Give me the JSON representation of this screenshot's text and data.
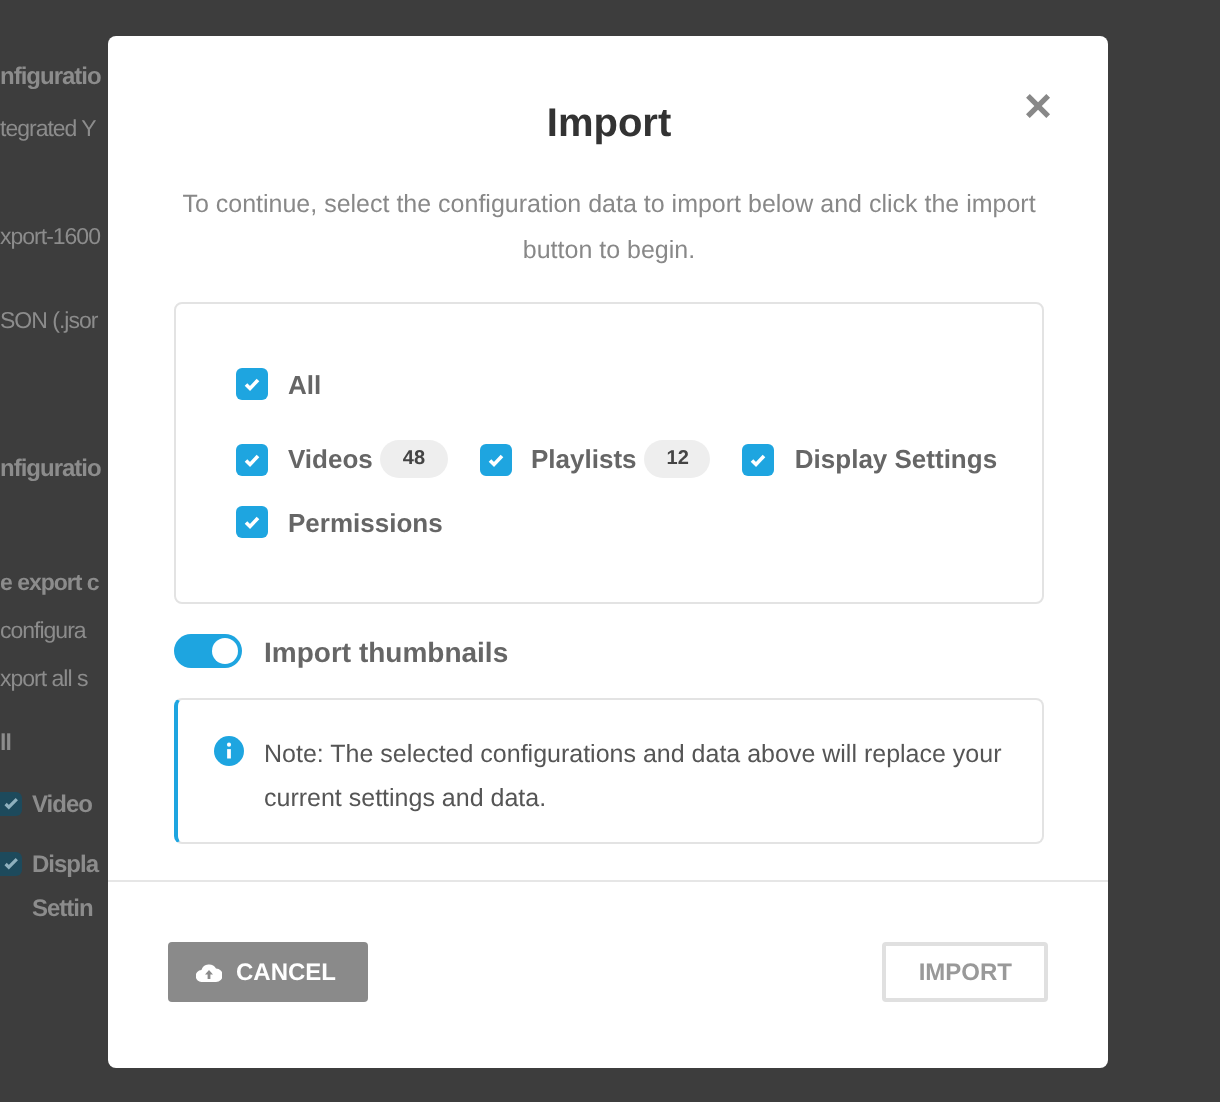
{
  "background_page": {
    "items": [
      {
        "kind": "heading",
        "text": "nfiguratio"
      },
      {
        "kind": "text",
        "text": "tegrated Y"
      },
      {
        "kind": "row",
        "text": "xport-1600"
      },
      {
        "kind": "row",
        "text": "SON (.jsor"
      },
      {
        "kind": "heading",
        "text": "nfiguratio"
      },
      {
        "kind": "label",
        "text": "e export c"
      },
      {
        "kind": "text",
        "text": "configura"
      },
      {
        "kind": "text",
        "text": "xport all s"
      },
      {
        "kind": "label",
        "text": "ll"
      },
      {
        "kind": "checkbox",
        "text": "Video",
        "checked": true
      },
      {
        "kind": "checkbox",
        "text": "Displa",
        "checked": true
      },
      {
        "kind": "continuation",
        "text": "Settin"
      }
    ]
  },
  "dialog": {
    "title": "Import",
    "close": "×",
    "description": "To continue, select the configuration data to import below and click the import button to begin.",
    "all": {
      "label": "All",
      "checked": true
    },
    "options": [
      {
        "label": "Videos",
        "count": "48",
        "checked": true
      },
      {
        "label": "Playlists",
        "count": "12",
        "checked": true
      },
      {
        "label": "Display Settings",
        "checked": true
      },
      {
        "label": "Permissions",
        "checked": true
      }
    ],
    "thumbnails": {
      "label": "Import thumbnails",
      "on": true
    },
    "note": "Note: The selected configurations and data above will replace your current settings and data.",
    "buttons": [
      {
        "label": "CANCEL",
        "kind": "filled"
      },
      {
        "label": "IMPORT",
        "kind": "outline"
      }
    ]
  }
}
